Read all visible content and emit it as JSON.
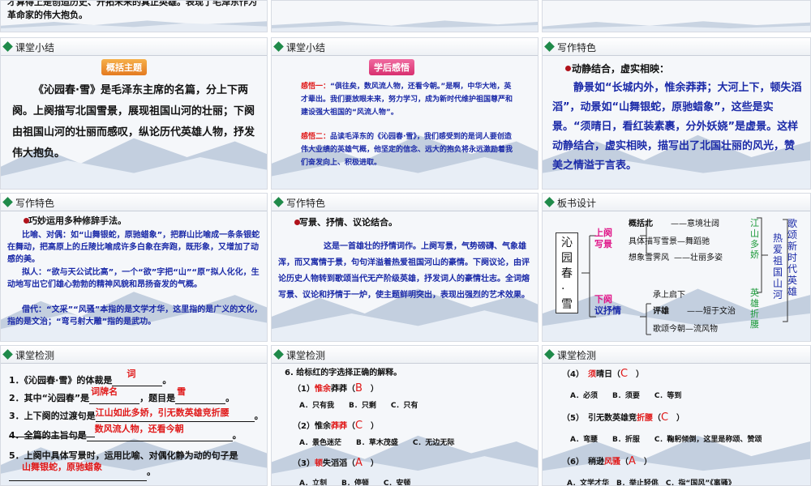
{
  "top_left_text": "才算得上是创造历史、开拓未来的真正英雄。表现了毛泽东作为革命家的伟大抱负。",
  "s1": {
    "title": "课堂小结",
    "badge": "概括主题",
    "p": "《沁园春·雪》是毛泽东主席的名篇，分上下两阕。上阕描写北国雪景，展现祖国山河的壮丽；下阕由祖国山河的壮丽而感叹，纵论历代英雄人物，抒发伟大抱负。"
  },
  "s2": {
    "title": "课堂小结",
    "badge": "学后感悟",
    "g1_label": "感悟一：",
    "g1": "“俱往矣，数风流人物，还看今朝。”是啊，中华大地，英才辈出。我们要放眼未来，努力学习，成为新时代维护祖国尊严和建设强大祖国的“风流人物”。",
    "g2_label": "感悟二：",
    "g2": "品读毛泽东的《沁园春·雪》，我们感受到的是词人要创造伟大业绩的英雄气概，他坚定的信念、远大的抱负将永远激励着我们奋发向上、积极进取。"
  },
  "s3": {
    "title": "写作特色",
    "head": "动静结合，虚实相映：",
    "p": "静景如“长城内外，惟余莽莽；大河上下，顿失滔滔”，动景如“山舞银蛇，原驰蜡象”，这些是实景。“须晴日，看红装素裹，分外妖娆”是虚景。这样动静结合，虚实相映，描写出了北国壮丽的风光，赞美之情溢于言表。"
  },
  "s4": {
    "title": "写作特色",
    "head": "巧妙运用多种修辞手法。",
    "p1": "比喻、对偶：如“山舞银蛇，原驰蜡象”，把群山比喻成一条条银蛇在舞动，把高原上的丘陵比喻成许多白象在奔跑，既形象，又增加了动感的美。",
    "p2": "拟人：“欲与天公试比高”，一个“欲”字把“山”“原”拟人化化，生动地写出它们雄心勃勃的精神风貌和昂扬奋发的气概。",
    "p3": "借代：“文采”“风骚”本指的是文学才华，这里指的是广义的文化，指的是文治；“弯弓射大雕”指的是武功。"
  },
  "s5": {
    "title": "写作特色",
    "head": "写景、抒情、议论结合。",
    "p": "这是一首雄壮的抒情词作。上阕写景，气势磅礴、气象雄浑，而又寓情于景，句句洋溢着热爱祖国河山的豪情。下阕议论，由评论历史人物转到歌颂当代无产阶级英雄，抒发词人的豪情壮志。全词熔写景、议论和抒情于一炉，使主题鲜明突出，表现出强烈的艺术效果。"
  },
  "s6": {
    "title": "板书设计",
    "poem": "沁园春·雪",
    "up1": "上阕",
    "up2": "写景",
    "u_rows": [
      {
        "a": "概括北",
        "b": "——意境壮阔"
      },
      {
        "a": "具体描写雪景—舞蹈驰",
        "b": ""
      },
      {
        "a": "想象雪霁风",
        "b": "——壮丽多姿"
      }
    ],
    "u_side": "江山多娇",
    "down1": "下阕",
    "down2": "议抒情",
    "d_rows": [
      {
        "a": "承上启下",
        "b": ""
      },
      {
        "a": "评雄",
        "b": "——短于文治"
      },
      {
        "a": "歌颂今朝—流风物",
        "b": ""
      }
    ],
    "d_side": "英雄折腰",
    "right_col1": "热爱祖国山河",
    "right_col2": "歌颂新时代英雄"
  },
  "s7": {
    "title": "课堂检测",
    "q1a": "1．《沁园春·雪》的体裁是",
    "q1ans": "词",
    "q2a": "2．其中“沁园春”是",
    "q2ans": "词牌名",
    "q2b": "，题目是",
    "q2ans2": "雪",
    "q3a": "3．上下阕的过渡句是",
    "q3ans": "江山如此多娇，引无数英雄竞折腰",
    "q4a": "4．全篇的主旨句是",
    "q4ans": "数风流人物，还看今朝",
    "q5a": "5．上阕中具体写景时，运用比喻、对偶化静为动的句子是",
    "q5ans": "山舞银蛇，原驰蜡象"
  },
  "s8": {
    "title": "课堂检测",
    "intro": "6. 给标红的字选择正确的解释。",
    "items": [
      {
        "n": "（1）",
        "w1": "惟余",
        "w2": "莽莽",
        "ans": "B",
        "opts": "A．只有我　　B．只剩　　C．只有"
      },
      {
        "n": "（2）",
        "w1": "惟余",
        "w2": "莽莽",
        "ans": "C",
        "opts": "A．景色迷茫　　B．草木茂盛　　C．无边无际"
      },
      {
        "n": "（3）",
        "w1": "顿",
        "w2": "失滔滔",
        "ans": "A",
        "opts": "A．立刻　　B．停顿　　C．安顿"
      }
    ]
  },
  "s9": {
    "title": "课堂检测",
    "items": [
      {
        "n": "（4）",
        "pre": "",
        "w": "须",
        "post": "晴日",
        "ans": "C",
        "opts": "A．必须　　B．须要　　C．等到"
      },
      {
        "n": "（5）",
        "pre": "引无数英雄竞",
        "w": "折腰",
        "post": "",
        "ans": "C",
        "opts": "A．弯腰　　B．折服　　C．鞠躬倾倒，这里是称颂、赞颂"
      },
      {
        "n": "（6）",
        "pre": "稍逊",
        "w": "风骚",
        "post": "",
        "ans": "A",
        "opts": "A．文学才华　B．举止轻佻　C．指“国风”《离骚》"
      }
    ]
  }
}
